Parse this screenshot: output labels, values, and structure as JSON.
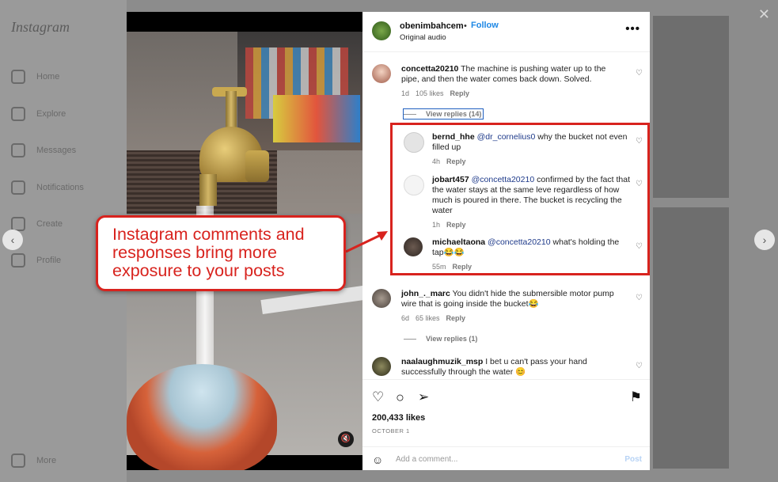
{
  "background": {
    "logo": "Instagram",
    "nav_items": [
      "Home",
      "Explore",
      "Messages",
      "Notifications",
      "Create",
      "Profile",
      "More"
    ]
  },
  "post": {
    "author": "obenimbahcem",
    "separator": "•",
    "follow_label": "Follow",
    "audio": "Original audio",
    "more_icon": "•••",
    "likes": "200,433 likes",
    "date": "OCTOBER 1"
  },
  "comments": [
    {
      "user": "concetta20210",
      "text": "The machine is pushing water up to the pipe, and then the water comes back down. Solved.",
      "time": "1d",
      "likes": "105 likes",
      "reply": "Reply"
    },
    {
      "user": "john_._marc",
      "text": "You didn't hide the submersible motor pump wire that is going inside the bucket😂",
      "time": "6d",
      "likes": "65 likes",
      "reply": "Reply"
    },
    {
      "user": "naalaughmuzik_msp",
      "text": "I bet u can't pass your hand successfully through the water 😊"
    }
  ],
  "view_replies": [
    "View replies (14)",
    "View replies (1)"
  ],
  "replies": [
    {
      "user": "bernd_hhe",
      "mention": "@dr_cornelius0",
      "text": "why the bucket not even filled up",
      "time": "4h",
      "reply": "Reply"
    },
    {
      "user": "jobart457",
      "mention": "@concetta20210",
      "text": "confirmed by the fact that the water stays at the same leve regardless of how much is poured in there. The bucket is recycling the water",
      "time": "1h",
      "reply": "Reply"
    },
    {
      "user": "michaeltaona",
      "mention": "@concetta20210",
      "text": "what's holding the tap😂😂",
      "time": "55m",
      "reply": "Reply"
    }
  ],
  "add_comment": {
    "placeholder": "Add a comment...",
    "post_label": "Post"
  },
  "callout": "Instagram comments and responses bring more exposure to your posts",
  "icons": {
    "close": "✕",
    "prev": "‹",
    "next": "›",
    "mute": "🔇",
    "heart": "♡",
    "like": "♡",
    "comment": "○",
    "share": "➢",
    "save": "⚑",
    "smile": "☺"
  },
  "colors": {
    "accent": "#d8231e",
    "link": "#1e88e5",
    "mention": "#1e3a8a"
  }
}
